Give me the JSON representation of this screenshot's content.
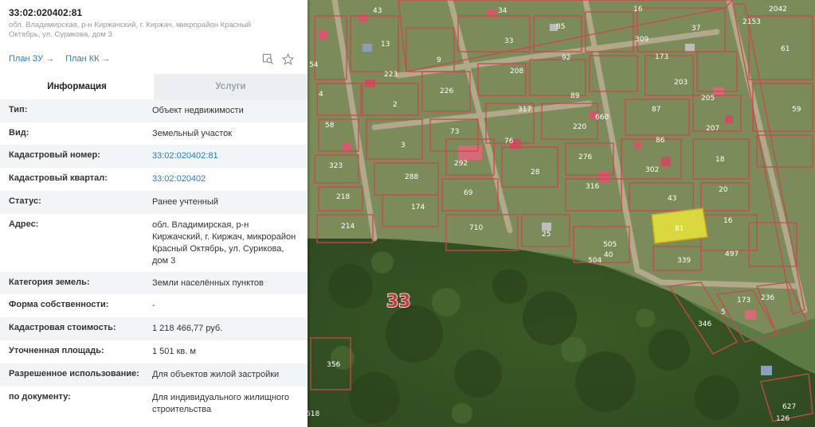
{
  "header": {
    "cadastral_number": "33:02:020402:81",
    "address_short": "обл. Владимирская, р-н Киржачский, г. Киржач, микрорайон Красный Октябрь, ул. Сурикова, дом 3",
    "plan_zu": "План ЗУ →",
    "plan_kk": "План КК →"
  },
  "tabs": {
    "info": "Информация",
    "services": "Услуги"
  },
  "rows": [
    {
      "label": "Тип:",
      "value": "Объект недвижимости"
    },
    {
      "label": "Вид:",
      "value": "Земельный участок"
    },
    {
      "label": "Кадастровый номер:",
      "value": "33:02:020402:81"
    },
    {
      "label": "Кадастровый квартал:",
      "value": "33:02:020402"
    },
    {
      "label": "Статус:",
      "value": "Ранее учтенный"
    },
    {
      "label": "Адрес:",
      "value": "обл. Владимирская, р-н Киржачский, г. Киржач, микрорайон Красный Октябрь, ул. Сурикова, дом 3"
    },
    {
      "label": "Категория земель:",
      "value": "Земли населённых пунктов"
    },
    {
      "label": "Форма собственности:",
      "value": "-"
    },
    {
      "label": "Кадастровая стоимость:",
      "value": "1 218 466,77 руб."
    },
    {
      "label": "Уточненная площадь:",
      "value": "1 501 кв. м"
    },
    {
      "label": "Разрешенное использование:",
      "value": "Для объектов жилой застройки"
    },
    {
      "label": "по документу:",
      "value": "Для индивидуального жилищного строительства"
    }
  ],
  "map": {
    "block_label": "33",
    "selected_plot": "81",
    "plot_labels": [
      "34",
      "16",
      "37",
      "2042",
      "43",
      "85",
      "309",
      "61",
      "13",
      "33",
      "92",
      "54",
      "9",
      "223",
      "208",
      "173",
      "4",
      "226",
      "89",
      "203",
      "205",
      "59",
      "2",
      "317",
      "87",
      "58",
      "73",
      "3",
      "76",
      "220",
      "207",
      "86",
      "292",
      "323",
      "288",
      "28",
      "302",
      "18",
      "316",
      "69",
      "43",
      "20",
      "218",
      "174",
      "710",
      "16",
      "214",
      "25",
      "505",
      "497",
      "40",
      "504",
      "339",
      "356",
      "618",
      "627",
      "126",
      "346",
      "173",
      "236",
      "5"
    ],
    "road_labels": [
      "2153",
      "660",
      "276"
    ]
  },
  "colors": {
    "accent": "#2a7bc0",
    "plot_border": "#c64a4a",
    "selected_fill": "#e8e63a"
  }
}
